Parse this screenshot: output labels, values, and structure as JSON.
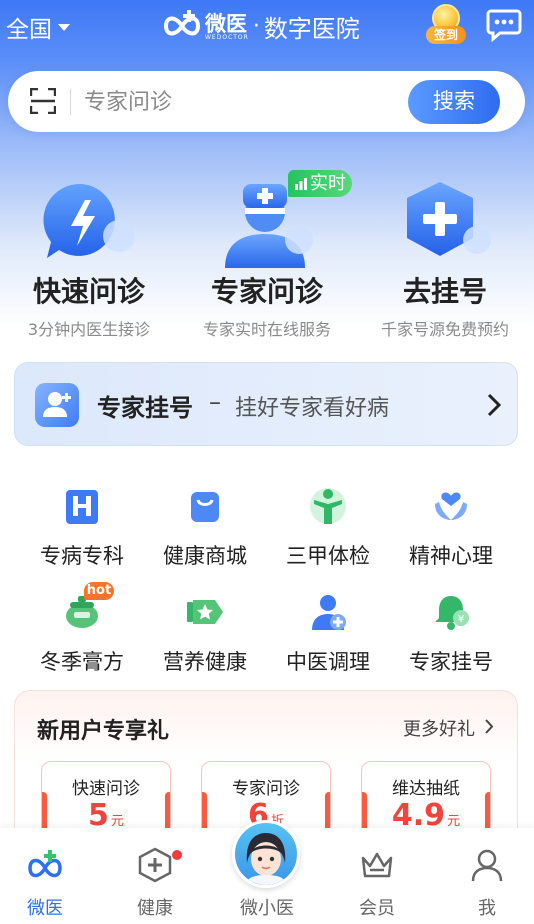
{
  "header": {
    "region": "全国",
    "brand_cn": "微医",
    "brand_en": "WEDOCTOR",
    "brand_dot": "·",
    "brand_sub": "数字医院",
    "checkin_label": "签到"
  },
  "search": {
    "placeholder": "专家问诊",
    "button_label": "搜索"
  },
  "services": [
    {
      "title": "快速问诊",
      "subtitle": "3分钟内医生接诊",
      "icon": "lightning-chat-icon"
    },
    {
      "title": "专家问诊",
      "subtitle": "专家实时在线服务",
      "icon": "doctor-icon",
      "badge": "实时"
    },
    {
      "title": "去挂号",
      "subtitle": "千家号源免费预约",
      "icon": "plus-hexagon-icon"
    }
  ],
  "banner": {
    "title": "专家挂号",
    "dash": "–",
    "subtitle": "挂好专家看好病"
  },
  "grid": [
    {
      "label": "专病专科",
      "icon": "hospital-icon"
    },
    {
      "label": "健康商城",
      "icon": "shopping-bag-icon"
    },
    {
      "label": "三甲体检",
      "icon": "fitness-person-icon"
    },
    {
      "label": "精神心理",
      "icon": "heart-hands-icon"
    },
    {
      "label": "冬季膏方",
      "icon": "herbal-pot-icon",
      "tag": "hot"
    },
    {
      "label": "营养健康",
      "icon": "nutrition-tube-icon"
    },
    {
      "label": "中医调理",
      "icon": "tcm-doctor-icon"
    },
    {
      "label": "专家挂号",
      "icon": "bell-icon"
    }
  ],
  "gift": {
    "title": "新用户专享礼",
    "more": "更多好礼",
    "coupons": [
      {
        "name": "快速问诊",
        "amount": "5",
        "unit": "元"
      },
      {
        "name": "专家问诊",
        "amount": "6",
        "unit": "折"
      },
      {
        "name": "维达抽纸",
        "amount": "4.9",
        "unit": "元"
      }
    ]
  },
  "tabbar": [
    {
      "label": "微医",
      "icon": "wedoctor-logo-icon",
      "active": true
    },
    {
      "label": "健康",
      "icon": "health-hexagon-icon"
    },
    {
      "label": "微小医",
      "icon": "ai-assistant-avatar"
    },
    {
      "label": "会员",
      "icon": "crown-icon"
    },
    {
      "label": "我",
      "icon": "user-icon"
    }
  ],
  "colors": {
    "primary": "#2f6ff3",
    "live_badge": "#24c45f",
    "coupon_red": "#f2443a",
    "hot_tag": "#f7742a"
  }
}
